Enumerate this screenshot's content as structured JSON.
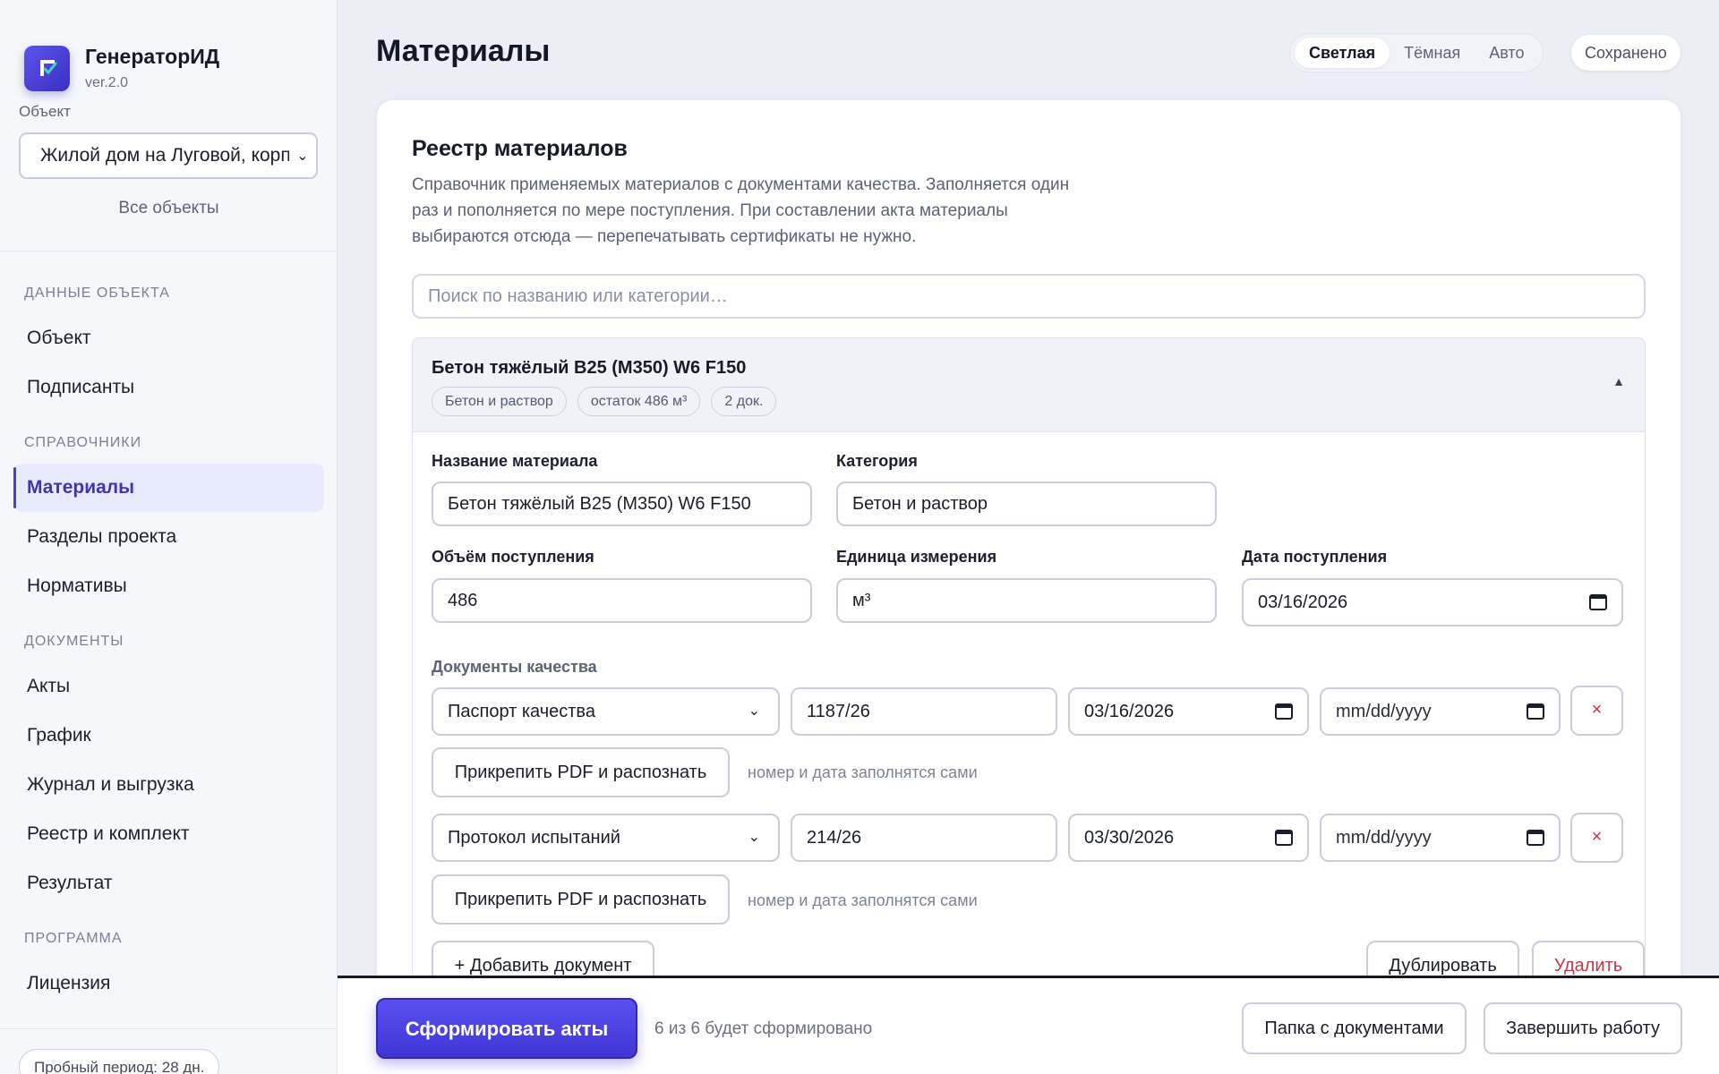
{
  "app": {
    "name": "ГенераторИД",
    "version": "ver.2.0"
  },
  "sidebar": {
    "object_label": "Объект",
    "object_selected": "Жилой дом на Луговой, корп",
    "all_objects": "Все объекты",
    "sections": [
      {
        "title": "ДАННЫЕ ОБЪЕКТА",
        "items": [
          {
            "label": "Объект"
          },
          {
            "label": "Подписанты"
          }
        ]
      },
      {
        "title": "СПРАВОЧНИКИ",
        "items": [
          {
            "label": "Материалы",
            "active": true
          },
          {
            "label": "Разделы проекта"
          },
          {
            "label": "Нормативы"
          }
        ]
      },
      {
        "title": "ДОКУМЕНТЫ",
        "items": [
          {
            "label": "Акты"
          },
          {
            "label": "График"
          },
          {
            "label": "Журнал и выгрузка"
          },
          {
            "label": "Реестр и комплект"
          },
          {
            "label": "Результат"
          }
        ]
      },
      {
        "title": "ПРОГРАММА",
        "items": [
          {
            "label": "Лицензия"
          }
        ]
      }
    ],
    "trial": "Пробный период: 28 дн."
  },
  "header": {
    "title": "Материалы",
    "theme_options": [
      "Светлая",
      "Тёмная",
      "Авто"
    ],
    "theme_selected": "Светлая",
    "saved_status": "Сохранено"
  },
  "registry": {
    "title": "Реестр материалов",
    "description": "Справочник применяемых материалов с документами качества. Заполняется один раз и пополняется по мере поступления. При составлении акта материалы выбираются отсюда — перепечатывать сертификаты не нужно.",
    "search_placeholder": "Поиск по названию или категории…"
  },
  "material": {
    "name": "Бетон тяжёлый B25 (М350) W6 F150",
    "chips": [
      "Бетон и раствор",
      "остаток 486 м³",
      "2 док."
    ],
    "fields": {
      "name_label": "Название материала",
      "name_value": "Бетон тяжёлый B25 (М350) W6 F150",
      "category_label": "Категория",
      "category_value": "Бетон и раствор",
      "volume_label": "Объём поступления",
      "volume_value": "486",
      "unit_label": "Единица измерения",
      "unit_value": "м³",
      "date_label": "Дата поступления",
      "date_value": "03/16/2026"
    },
    "quality_docs_label": "Документы качества",
    "quality_docs": [
      {
        "type": "Паспорт качества",
        "number": "1187/26",
        "date": "03/16/2026",
        "valid_until": "mm/dd/yyyy",
        "attach_label": "Прикрепить PDF и распознать",
        "hint": "номер и дата заполнятся сами"
      },
      {
        "type": "Протокол испытаний",
        "number": "214/26",
        "date": "03/30/2026",
        "valid_until": "mm/dd/yyyy",
        "attach_label": "Прикрепить PDF и распознать",
        "hint": "номер и дата заполнятся сами"
      }
    ],
    "remove_symbol": "×",
    "add_document": "+ Добавить документ",
    "duplicate": "Дублировать",
    "delete": "Удалить"
  },
  "bottom_bar": {
    "generate": "Сформировать акты",
    "status": "6 из 6 будет сформировано",
    "folder": "Папка с документами",
    "finish": "Завершить работу"
  },
  "colors": {
    "accent": "#4a3fd0",
    "danger": "#c0394b"
  }
}
